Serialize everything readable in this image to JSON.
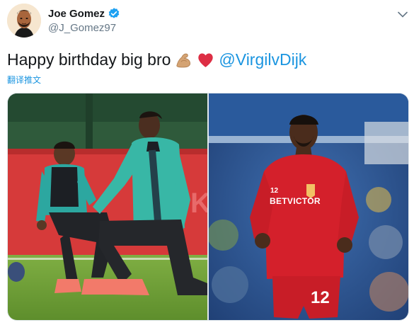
{
  "author": {
    "display_name": "Joe Gomez",
    "handle": "@J_Gomez97",
    "verified": true,
    "avatar_icon": "cartoon-avatar-icon"
  },
  "menu": {
    "icon": "chevron-down-icon"
  },
  "tweet": {
    "text": "Happy birthday big bro",
    "emojis": [
      "flexed-biceps-icon",
      "red-heart-icon"
    ],
    "mention": "@VirgilvDijk",
    "translate_label": "翻译推文"
  },
  "media": {
    "photos": [
      {
        "name": "training-photo"
      },
      {
        "name": "red-kit-photo",
        "kit_sponsor": "BETVICTOR",
        "kit_number": "12"
      }
    ]
  },
  "colors": {
    "link": "#1b95e0",
    "verified": "#1da1f2",
    "text": "#14171a",
    "muted": "#657786"
  }
}
